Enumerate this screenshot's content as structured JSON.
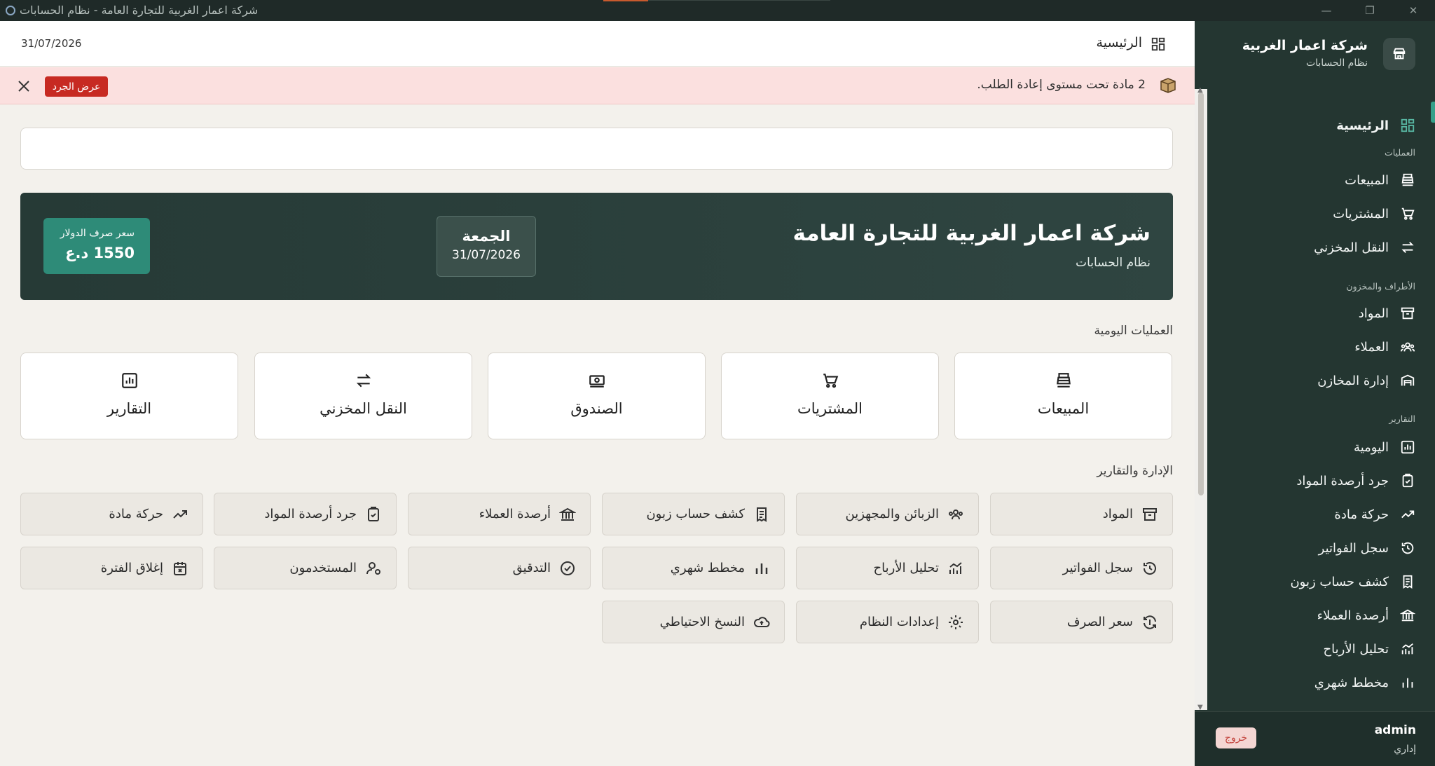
{
  "window": {
    "title": "شركة اعمار الغربية للتجارة العامة - نظام الحسابات"
  },
  "sidebar": {
    "company": "شركة اعمار الغربية",
    "subtitle": "نظام الحسابات",
    "home": "الرئيسية",
    "sections": {
      "operations": "العمليات",
      "parties": "الأطراف والمخزون",
      "reports": "التقارير"
    },
    "items": {
      "sales": "المبيعات",
      "purchases": "المشتريات",
      "transfer": "النقل المخزني",
      "materials": "المواد",
      "customers": "العملاء",
      "warehouses": "إدارة المخازن",
      "daily": "اليومية",
      "stocktake": "جرد أرصدة المواد",
      "movement": "حركة مادة",
      "invoices": "سجل الفواتير",
      "statement": "كشف حساب زبون",
      "balances": "أرصدة العملاء",
      "profit": "تحليل الأرباح",
      "monthly": "مخطط شهري"
    },
    "user": "admin",
    "role": "إداري",
    "logout": "خروج"
  },
  "topbar": {
    "title": "الرئيسية",
    "date": "31/07/2026"
  },
  "alert": {
    "message": "2 مادة تحت مستوى إعادة الطلب.",
    "action": "عرض الجرد"
  },
  "banner": {
    "company": "شركة اعمار الغربية للتجارة العامة",
    "subtitle": "نظام الحسابات",
    "day": "الجمعة",
    "date": "31/07/2026",
    "rate_label": "سعر صرف الدولار",
    "rate_value": "1550 د.ع"
  },
  "daily_ops": {
    "title": "العمليات اليومية",
    "tiles": [
      "المبيعات",
      "المشتريات",
      "الصندوق",
      "النقل المخزني",
      "التقارير"
    ]
  },
  "admin": {
    "title": "الإدارة والتقارير",
    "buttons": [
      "المواد",
      "الزبائن والمجهزين",
      "كشف حساب زبون",
      "أرصدة العملاء",
      "جرد أرصدة المواد",
      "حركة مادة",
      "سجل الفواتير",
      "تحليل الأرباح",
      "مخطط شهري",
      "التدقيق",
      "المستخدمون",
      "إغلاق الفترة",
      "سعر الصرف",
      "إعدادات النظام",
      "النسخ الاحتياطي"
    ]
  },
  "colors": {
    "sidebar": "#243631",
    "accent": "#2e8b78",
    "alert_bg": "#fbe0df",
    "danger": "#c72a22"
  }
}
